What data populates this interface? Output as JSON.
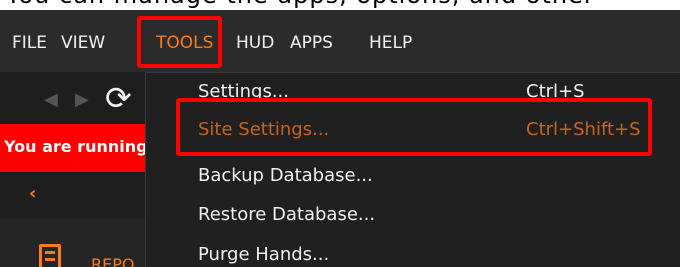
{
  "top_strip_text": "You can manage the apps, options, and other",
  "menubar": {
    "items": [
      {
        "label": "FILE",
        "active": false
      },
      {
        "label": "VIEW",
        "active": false
      },
      {
        "label": "TOOLS",
        "active": true
      },
      {
        "label": "HUD",
        "active": false
      },
      {
        "label": "APPS",
        "active": false
      },
      {
        "label": "HELP",
        "active": false
      }
    ]
  },
  "toolbar": {
    "back_icon": "◀",
    "forward_icon": "▶",
    "refresh_icon": "⟳"
  },
  "banner": {
    "text": "You are running"
  },
  "sidebar": {
    "collapse_icon": "‹",
    "reports_label": "REPO"
  },
  "tools_menu": {
    "items": [
      {
        "label": "Settings...",
        "shortcut": "Ctrl+S",
        "highlighted": false
      },
      {
        "label": "Site Settings...",
        "shortcut": "Ctrl+Shift+S",
        "highlighted": true
      },
      {
        "label": "Backup Database...",
        "shortcut": "",
        "highlighted": false
      },
      {
        "label": "Restore Database...",
        "shortcut": "",
        "highlighted": false
      },
      {
        "label": "Purge Hands...",
        "shortcut": "",
        "highlighted": false
      }
    ]
  },
  "colors": {
    "accent": "#ff7a18",
    "highlight_text": "#c8641e",
    "annotation_red": "#ff0000",
    "menu_bg": "#2b2b2b",
    "dropdown_bg": "#202020"
  }
}
